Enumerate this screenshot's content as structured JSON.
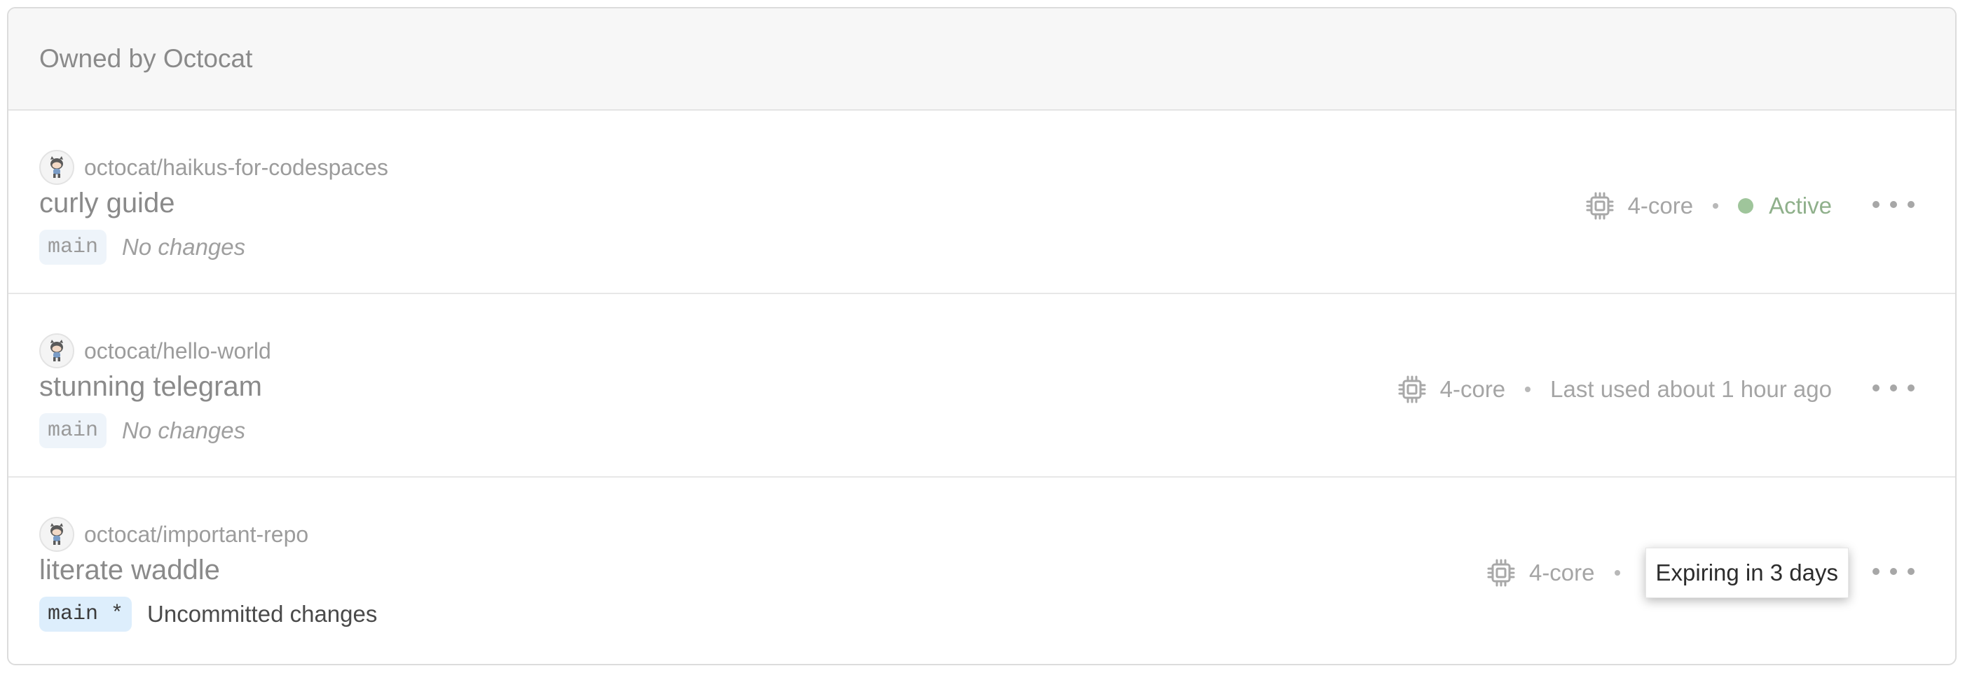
{
  "section": {
    "title": "Owned by Octocat"
  },
  "codespaces": [
    {
      "repo": "octocat/haikus-for-codespaces",
      "name": "curly guide",
      "branch": "main",
      "changes": "No changes",
      "machine": "4-core",
      "status": "Active",
      "status_color": "#9fc59b"
    },
    {
      "repo": "octocat/hello-world",
      "name": "stunning telegram",
      "branch": "main",
      "changes": "No changes",
      "machine": "4-core",
      "status": "Last used about 1 hour ago"
    },
    {
      "repo": "octocat/important-repo",
      "name": "literate waddle",
      "branch": "main *",
      "changes": "Uncommitted changes",
      "machine": "4-core",
      "tooltip": "Expiring in 3 days"
    }
  ],
  "icons": {
    "avatar": "octocat-avatar-icon",
    "machine": "cpu-icon",
    "more": "kebab-horizontal-icon"
  },
  "colors": {
    "header_bg": "#f7f7f7",
    "active_green": "#9fc59b",
    "branch_bg": "#eef4fa",
    "dirty_branch_bg": "#ddeefc"
  }
}
